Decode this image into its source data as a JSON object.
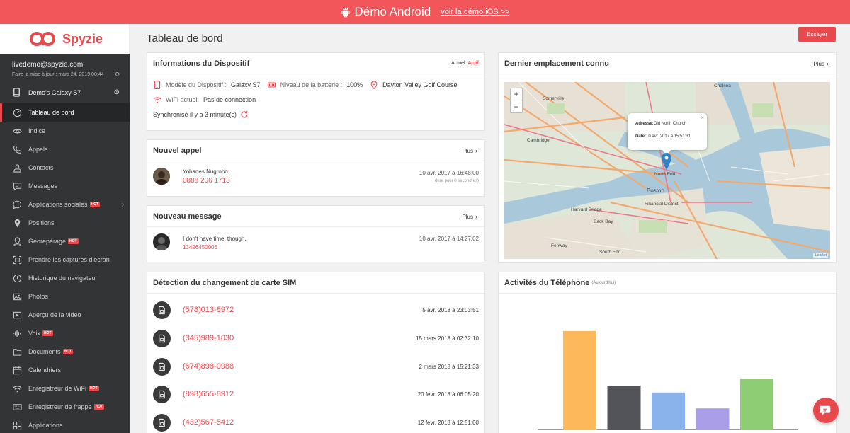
{
  "banner": {
    "title": "Démo Android",
    "link": "voir la démo iOS >>"
  },
  "brand": {
    "name": "Spyzie"
  },
  "account": {
    "email": "livedemo@spyzie.com",
    "last_update": "Faire la mise à jour : mars 24, 2019 00:44"
  },
  "device": {
    "name": "Demo's Galaxy S7"
  },
  "nav": [
    {
      "label": "Tableau de bord",
      "icon": "dashboard-icon",
      "active": true
    },
    {
      "label": "Indice",
      "icon": "eye-icon"
    },
    {
      "label": "Appels",
      "icon": "phone-icon"
    },
    {
      "label": "Contacts",
      "icon": "contact-icon"
    },
    {
      "label": "Messages",
      "icon": "message-icon"
    },
    {
      "label": "Applications sociales",
      "icon": "chat-bubble-icon",
      "hot": "HOT",
      "chevron": true
    },
    {
      "label": "Positions",
      "icon": "location-pin-icon"
    },
    {
      "label": "Géorepérage",
      "icon": "geofence-icon",
      "hot": "HOT"
    },
    {
      "label": "Prendre les captures d'écran",
      "icon": "screenshot-icon"
    },
    {
      "label": "Historique du navigateur",
      "icon": "clock-icon"
    },
    {
      "label": "Photos",
      "icon": "photo-icon"
    },
    {
      "label": "Aperçu de la vidéo",
      "icon": "video-icon"
    },
    {
      "label": "Voix",
      "icon": "audio-wave-icon",
      "hot": "HOT"
    },
    {
      "label": "Documents",
      "icon": "folder-icon",
      "hot": "HOT"
    },
    {
      "label": "Calendriers",
      "icon": "calendar-icon"
    },
    {
      "label": "Enregistreur de WiFi",
      "icon": "wifi-icon",
      "hot": "HOT"
    },
    {
      "label": "Enregistreur de frappe",
      "icon": "keyboard-icon",
      "hot": "HOT"
    },
    {
      "label": "Applications",
      "icon": "apps-icon"
    }
  ],
  "header": {
    "title": "Tableau de bord",
    "try_label": "Essayer"
  },
  "device_info": {
    "title": "Informations du Dispositif",
    "status_label": "Actuel:",
    "status_value": "Actif",
    "model_label": "Modèle du Dispositif :",
    "model_value": "Galaxy S7",
    "battery_label": "Niveau de la batterie :",
    "battery_value": "100%",
    "location": "Dayton Valley Golf Course",
    "wifi_label": "WiFi actuel:",
    "wifi_value": "Pas de connection",
    "synced": "Synchronisé il y a 3 minute(s)"
  },
  "last_call": {
    "title": "Nouvel appel",
    "more": "Plus",
    "name": "Yohanes Nugroho",
    "number": "0888 206 1713",
    "date": "10 avr. 2017 à 16:48:00",
    "duration": "dure pour 0 second(es)"
  },
  "last_message": {
    "title": "Nouveau message",
    "more": "Plus",
    "text": "I don't have time, though.",
    "number": "13426450006",
    "date": "10 avr. 2017 à 14:27:02"
  },
  "sim": {
    "title": "Détection du changement de carte SIM",
    "rows": [
      {
        "phone": "(578)013-8972",
        "date": "5 avr. 2018 à 23:03:51"
      },
      {
        "phone": "(345)989-1030",
        "date": "15 mars 2018 à 02:32:10"
      },
      {
        "phone": "(674)898-0988",
        "date": "2 mars 2018 à 15:21:33"
      },
      {
        "phone": "(898)655-8912",
        "date": "20 févr. 2018 à 06:05:20"
      },
      {
        "phone": "(432)567-5412",
        "date": "12 févr. 2018 à 12:51:00"
      }
    ]
  },
  "location": {
    "title": "Dernier emplacement connu",
    "more": "Plus",
    "zoom_in": "+",
    "zoom_out": "−",
    "address_label": "Adresse:",
    "address_value": "Old North Church",
    "date_label": "Date:",
    "date_value": "10 avr. 2017 à 15:51:31",
    "close": "×",
    "attribution": "Leaflet",
    "map_labels": {
      "somerville": "Somerville",
      "chelsea": "Chelsea",
      "cambridge": "Cambridge",
      "north_end": "North End",
      "boston": "Boston",
      "financial_district": "Financial District",
      "back_bay": "Back Bay",
      "fenway": "Fenway",
      "south_end": "South End",
      "harvard_bridge": "Harvard Bridge"
    }
  },
  "activity": {
    "title": "Activités du Téléphone",
    "subtitle": "(Aujourd'hui)"
  },
  "chart_data": {
    "type": "bar",
    "title": "Activités du Téléphone",
    "categories": [
      "",
      "",
      "",
      "",
      ""
    ],
    "values": [
      100,
      45,
      38,
      22,
      52
    ],
    "colors": [
      "#fdb85a",
      "#53535a",
      "#8ab3ec",
      "#ab9ee8",
      "#8ecd74"
    ],
    "ylim": [
      0,
      100
    ]
  },
  "colors": {
    "accent": "#e8494d",
    "sidebar": "#333436"
  }
}
